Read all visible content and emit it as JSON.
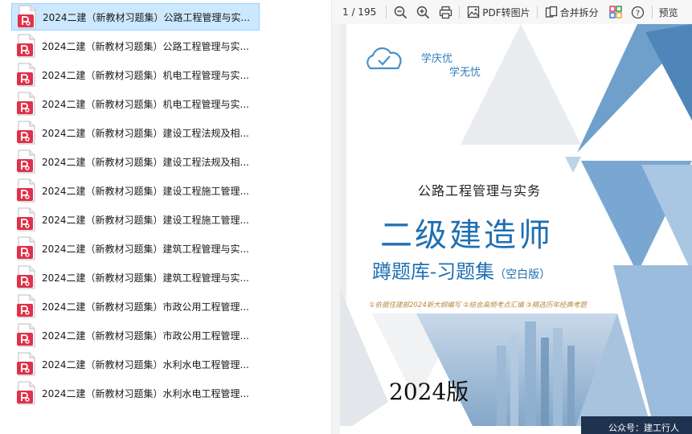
{
  "files": [
    {
      "name": "2024二建（新教材习题集）公路工程管理与实...",
      "selected": true
    },
    {
      "name": "2024二建（新教材习题集）公路工程管理与实...",
      "selected": false
    },
    {
      "name": "2024二建（新教材习题集）机电工程管理与实...",
      "selected": false
    },
    {
      "name": "2024二建（新教材习题集）机电工程管理与实...",
      "selected": false
    },
    {
      "name": "2024二建（新教材习题集）建设工程法规及相...",
      "selected": false
    },
    {
      "name": "2024二建（新教材习题集）建设工程法规及相...",
      "selected": false
    },
    {
      "name": "2024二建（新教材习题集）建设工程施工管理...",
      "selected": false
    },
    {
      "name": "2024二建（新教材习题集）建设工程施工管理...",
      "selected": false
    },
    {
      "name": "2024二建（新教材习题集）建筑工程管理与实...",
      "selected": false
    },
    {
      "name": "2024二建（新教材习题集）建筑工程管理与实...",
      "selected": false
    },
    {
      "name": "2024二建（新教材习题集）市政公用工程管理...",
      "selected": false
    },
    {
      "name": "2024二建（新教材习题集）市政公用工程管理...",
      "selected": false
    },
    {
      "name": "2024二建（新教材习题集）水利水电工程管理...",
      "selected": false
    },
    {
      "name": "2024二建（新教材习题集）水利水电工程管理...",
      "selected": false
    }
  ],
  "toolbar": {
    "page_indicator": "1 / 195",
    "pdf_to_image": "PDF转图片",
    "merge_split": "合并拆分",
    "preview": "预览"
  },
  "cover": {
    "logo_line1": "学庆优",
    "logo_line2": "学无忧",
    "subject": "公路工程管理与实务",
    "title": "二级建造师",
    "subtitle": "蹲题库-习题集",
    "subtitle_note": "（空白版）",
    "features": "①依据住建部2024新大纲编写 ②结合高频考点汇编 ③精选历年经典考题",
    "edition": "2024版",
    "footer": "公众号：建工行人"
  },
  "colors": {
    "pdf_icon": "#e0314b",
    "selection_bg": "#cce8ff",
    "cover_blue": "#1f6fb2",
    "triangle_blue": "#6f9fcb"
  }
}
